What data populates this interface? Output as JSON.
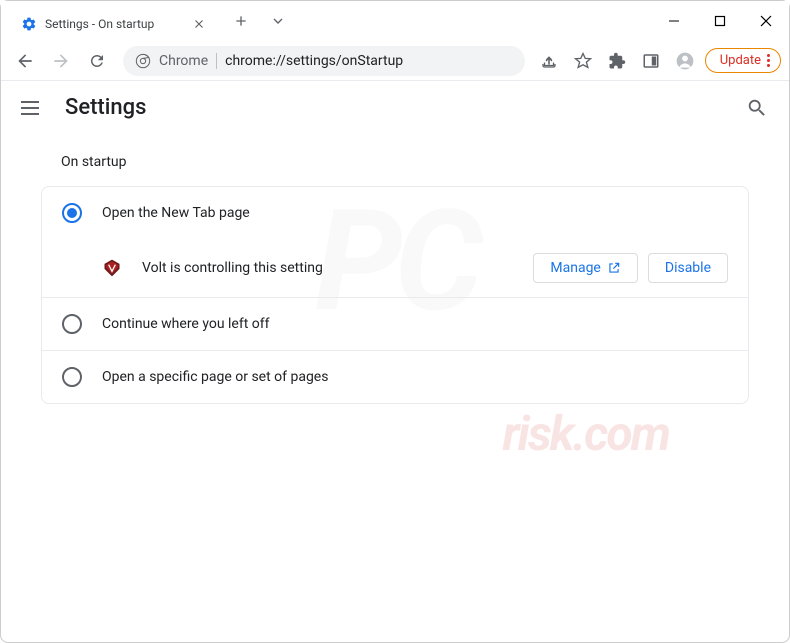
{
  "window": {
    "tab_title": "Settings - On startup"
  },
  "address": {
    "scheme": "Chrome",
    "url": "chrome://settings/onStartup",
    "update_label": "Update"
  },
  "header": {
    "title": "Settings"
  },
  "section": {
    "title": "On startup",
    "options": [
      {
        "label": "Open the New Tab page",
        "selected": true
      },
      {
        "label": "Continue where you left off",
        "selected": false
      },
      {
        "label": "Open a specific page or set of pages",
        "selected": false
      }
    ],
    "extension": {
      "name": "Volt",
      "message": "Volt is controlling this setting",
      "manage_label": "Manage",
      "disable_label": "Disable"
    }
  }
}
